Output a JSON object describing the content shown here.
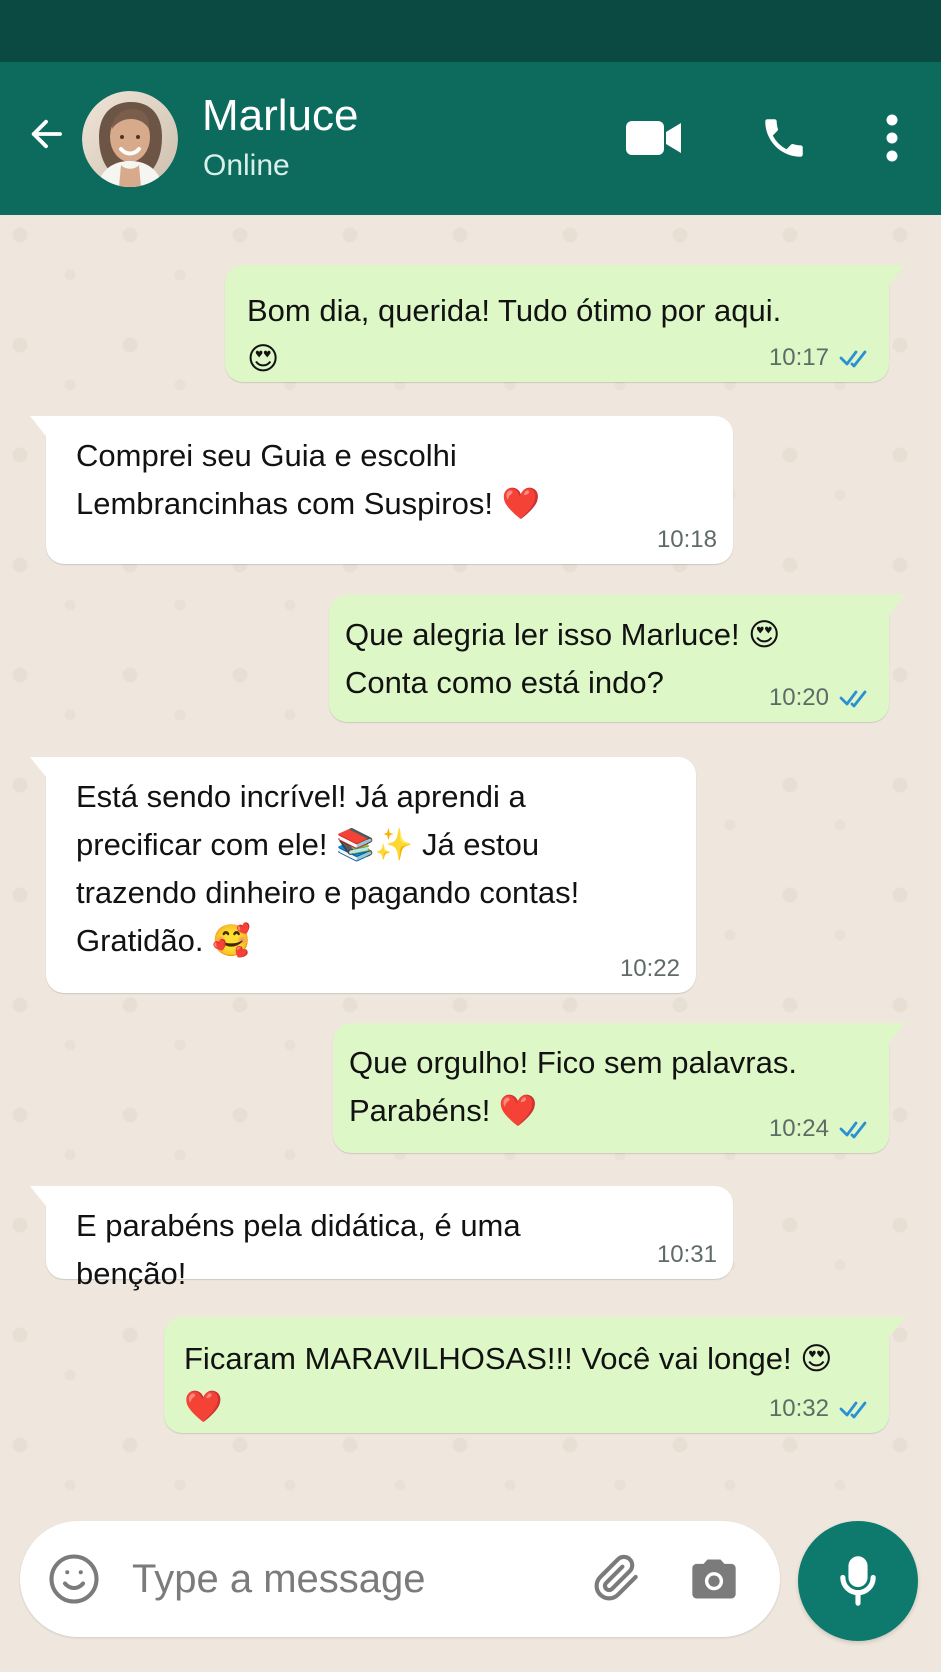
{
  "header": {
    "contact_name": "Marluce",
    "status": "Online",
    "icons": {
      "back": "arrow-left-icon",
      "avatar": "avatar",
      "video": "video-camera-icon",
      "call": "phone-icon",
      "menu": "more-vertical-icon"
    }
  },
  "messages": [
    {
      "direction": "outgoing",
      "text": "Bom dia, querida! Tudo ótimo por aqui. 😍",
      "time": "10:17",
      "read": true
    },
    {
      "direction": "incoming",
      "text": "Comprei seu Guia e escolhi\nLembrancinhas com Suspiros! ❤️",
      "time": "10:18"
    },
    {
      "direction": "outgoing",
      "text": "Que alegria ler isso Marluce! 😍\nConta como está indo?",
      "time": "10:20",
      "read": true
    },
    {
      "direction": "incoming",
      "text": "Está sendo incrível! Já aprendi a\nprecificar com ele! 📚✨ Já estou\ntrazendo dinheiro e pagando contas!\nGratidão. 🥰",
      "time": "10:22"
    },
    {
      "direction": "outgoing",
      "text": "Que orgulho! Fico sem palavras.\nParabéns! ❤️",
      "time": "10:24",
      "read": true
    },
    {
      "direction": "incoming",
      "text": "E parabéns pela didática, é uma benção!",
      "time": "10:31"
    },
    {
      "direction": "outgoing",
      "text": "Ficaram MARAVILHOSAS!!! Você vai longe! 😍❤️",
      "time": "10:32",
      "read": true
    }
  ],
  "composer": {
    "placeholder": "Type a message",
    "icons": {
      "emoji": "smile-icon",
      "attach": "paperclip-icon",
      "camera": "camera-icon",
      "mic": "microphone-icon"
    }
  },
  "colors": {
    "header": "#0d6b5e",
    "status_bar": "#0a4a43",
    "chat_background": "#efe7dd",
    "outgoing_bubble": "#ddf7c7",
    "incoming_bubble": "#ffffff",
    "read_ticks": "#2b8fd6",
    "mic_button": "#0d7a6d"
  }
}
